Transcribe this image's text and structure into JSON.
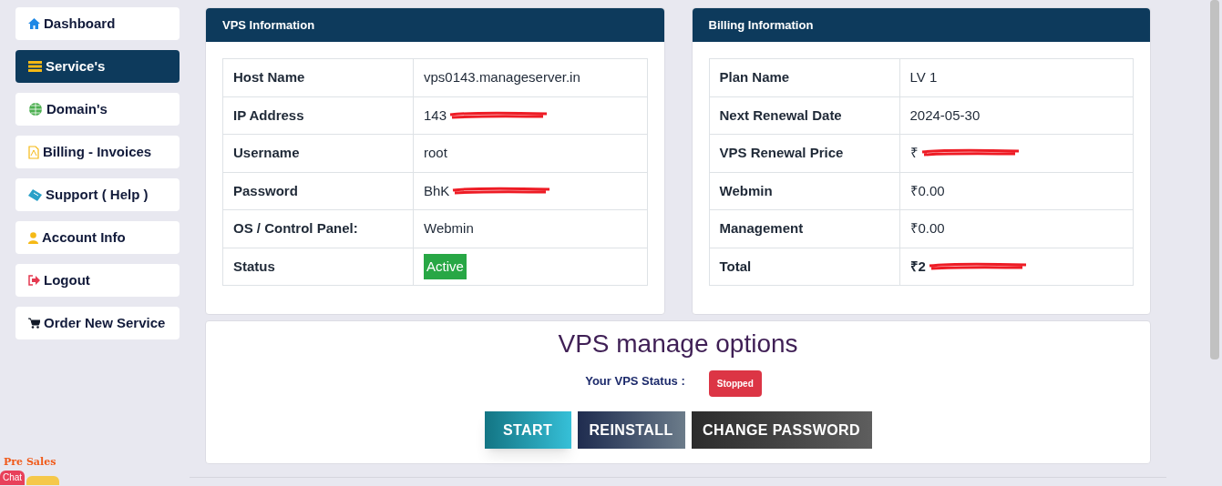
{
  "sidebar": {
    "items": [
      {
        "label": "Dashboard",
        "kind": "home",
        "selected": false
      },
      {
        "label": "Service's",
        "kind": "servers",
        "selected": true
      },
      {
        "label": "Domain's",
        "kind": "domains",
        "selected": false
      },
      {
        "label": "Billing - Invoices",
        "kind": "billing",
        "selected": false
      },
      {
        "label": "Support ( Help )",
        "kind": "support",
        "selected": false
      },
      {
        "label": "Account Info",
        "kind": "account",
        "selected": false
      },
      {
        "label": "Logout",
        "kind": "logout",
        "selected": false
      },
      {
        "label": "Order New Service",
        "kind": "order",
        "selected": false
      }
    ]
  },
  "vps_information": {
    "title": "VPS Information",
    "rows": [
      {
        "label": "Host Name",
        "value": "vps0143.manageserver.in",
        "kind": "text",
        "redacted": false
      },
      {
        "label": "IP Address",
        "value": "143",
        "kind": "text",
        "redacted": true
      },
      {
        "label": "Username",
        "value": "root",
        "kind": "text",
        "redacted": false
      },
      {
        "label": "Password",
        "value": "BhK",
        "kind": "text",
        "redacted": true
      },
      {
        "label": "OS / Control Panel:",
        "value": "Webmin",
        "kind": "text",
        "redacted": false
      },
      {
        "label": "Status",
        "value": "Active",
        "kind": "badge",
        "redacted": false
      }
    ]
  },
  "billing_information": {
    "title": "Billing Information",
    "rows": [
      {
        "label": "Plan Name",
        "value": "LV 1",
        "bold": false,
        "redacted": false
      },
      {
        "label": "Next Renewal Date",
        "value": "2024-05-30",
        "bold": false,
        "redacted": false
      },
      {
        "label": "VPS Renewal Price",
        "value": "₹",
        "bold": false,
        "redacted": true
      },
      {
        "label": "Webmin",
        "value": "₹0.00",
        "bold": false,
        "redacted": false
      },
      {
        "label": "Management",
        "value": "₹0.00",
        "bold": false,
        "redacted": false
      },
      {
        "label": "Total",
        "value": "₹2",
        "bold": true,
        "redacted": true
      }
    ]
  },
  "manage": {
    "title": "VPS manage options",
    "status_label": "Your VPS Status :",
    "status": "Stopped",
    "buttons": [
      {
        "label": "START",
        "kind": "start"
      },
      {
        "label": "REINSTALL",
        "kind": "reinstall"
      },
      {
        "label": "CHANGE PASSWORD",
        "kind": "password"
      }
    ]
  },
  "chat_widget": {
    "label": "Pre Sales",
    "button": "Chat"
  }
}
